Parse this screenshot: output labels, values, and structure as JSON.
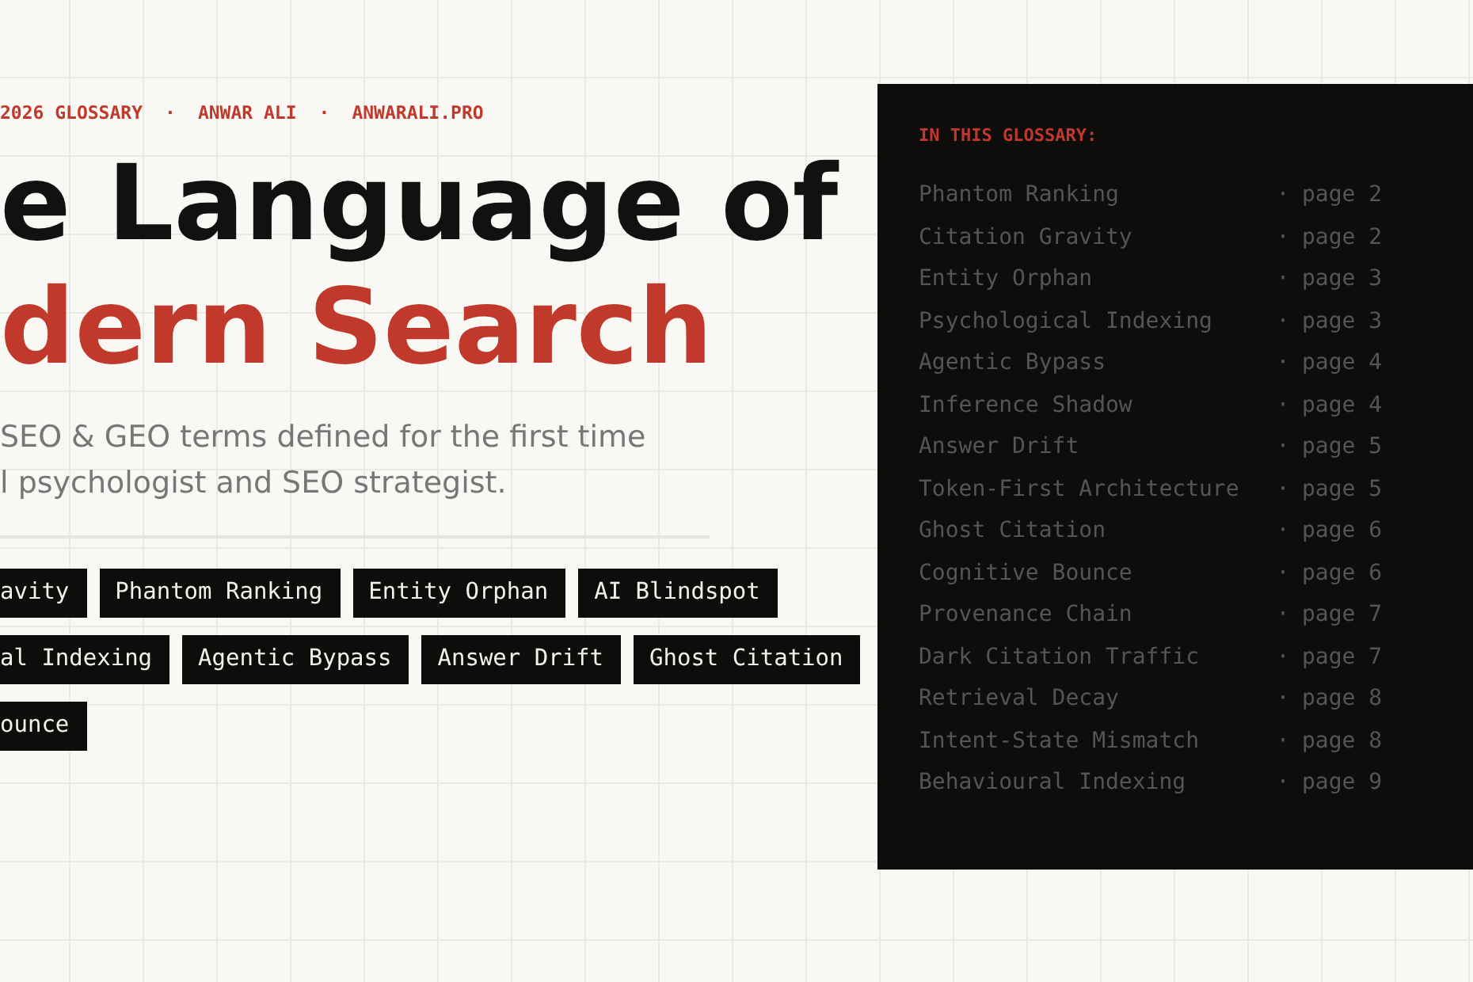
{
  "meta": [
    "2026 GLOSSARY",
    "·",
    "ANWAR ALI",
    "·",
    "ANWARALI.PRO"
  ],
  "title": {
    "line_1": "e Language of",
    "line_2": "dern Search"
  },
  "subtitle": {
    "line_1": "SEO & GEO terms defined for the first time",
    "line_2": "l psychologist and SEO strategist."
  },
  "tag_rows": [
    [
      "avity",
      "Phantom Ranking",
      "Entity Orphan",
      "AI Blindspot"
    ],
    [
      "al Indexing",
      "Agentic Bypass",
      "Answer Drift",
      "Ghost Citation"
    ],
    [
      "ounce"
    ]
  ],
  "toc": {
    "heading": "IN THIS GLOSSARY:",
    "rows": [
      {
        "term": "Phantom Ranking",
        "sep": "·",
        "page": "page 2"
      },
      {
        "term": "Citation Gravity",
        "sep": "·",
        "page": "page 2"
      },
      {
        "term": "Entity Orphan",
        "sep": "·",
        "page": "page 3"
      },
      {
        "term": "Psychological Indexing",
        "sep": "·",
        "page": "page 3"
      },
      {
        "term": "Agentic Bypass",
        "sep": "·",
        "page": "page 4"
      },
      {
        "term": "Inference Shadow",
        "sep": "·",
        "page": "page 4"
      },
      {
        "term": "Answer Drift",
        "sep": "·",
        "page": "page 5"
      },
      {
        "term": "Token-First Architecture",
        "sep": "·",
        "page": "page 5"
      },
      {
        "term": "Ghost Citation",
        "sep": "·",
        "page": "page 6"
      },
      {
        "term": "Cognitive Bounce",
        "sep": "·",
        "page": "page 6"
      },
      {
        "term": "Provenance Chain",
        "sep": "·",
        "page": "page 7"
      },
      {
        "term": "Dark Citation Traffic",
        "sep": "·",
        "page": "page 7"
      },
      {
        "term": "Retrieval Decay",
        "sep": "·",
        "page": "page 8"
      },
      {
        "term": "Intent-State Mismatch",
        "sep": "·",
        "page": "page 8"
      },
      {
        "term": "Behavioural Indexing",
        "sep": "·",
        "page": "page 9"
      }
    ]
  }
}
